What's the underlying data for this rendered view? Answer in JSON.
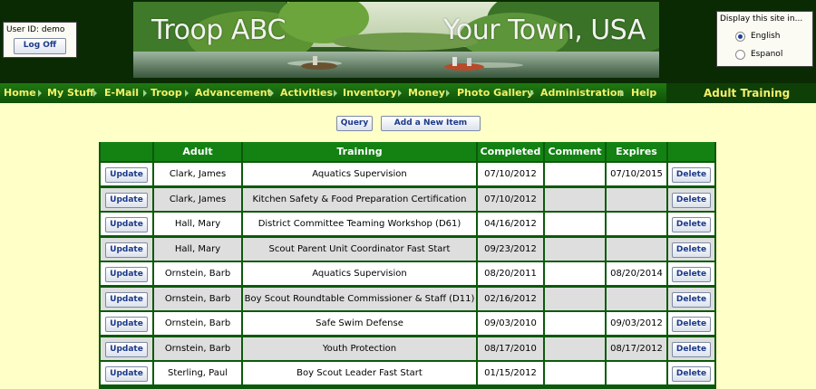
{
  "user": {
    "id_label": "User ID:  demo",
    "logoff_label": "Log Off"
  },
  "banner": {
    "left_text": "Troop ABC",
    "right_text": "Your Town, USA"
  },
  "language": {
    "title": "Display this site in...",
    "options": [
      {
        "label": "English",
        "selected": true
      },
      {
        "label": "Espanol",
        "selected": false
      }
    ]
  },
  "nav": {
    "items": [
      "Home",
      "My Stuff",
      "E-Mail",
      "Troop",
      "Advancement",
      "Activities",
      "Inventory",
      "Money",
      "Photo Gallery",
      "Administration",
      "Help"
    ],
    "page_title": "Adult Training"
  },
  "actions": {
    "query_label": "Query",
    "add_label": "Add a New Item"
  },
  "table": {
    "headers": [
      "",
      "Adult",
      "Training",
      "Completed",
      "Comment",
      "Expires",
      ""
    ],
    "update_label": "Update",
    "delete_label": "Delete",
    "rows": [
      {
        "adult": "Clark, James",
        "training": "Aquatics Supervision",
        "completed": "07/10/2012",
        "comment": "",
        "expires": "07/10/2015"
      },
      {
        "adult": "Clark, James",
        "training": "Kitchen Safety & Food Preparation Certification",
        "completed": "07/10/2012",
        "comment": "",
        "expires": ""
      },
      {
        "adult": "Hall, Mary",
        "training": "District Committee Teaming Workshop (D61)",
        "completed": "04/16/2012",
        "comment": "",
        "expires": ""
      },
      {
        "adult": "Hall, Mary",
        "training": "Scout Parent Unit Coordinator Fast Start",
        "completed": "09/23/2012",
        "comment": "",
        "expires": ""
      },
      {
        "adult": "Ornstein, Barb",
        "training": "Aquatics Supervision",
        "completed": "08/20/2011",
        "comment": "",
        "expires": "08/20/2014"
      },
      {
        "adult": "Ornstein, Barb",
        "training": "Boy Scout Roundtable Commissioner & Staff (D11)",
        "completed": "02/16/2012",
        "comment": "",
        "expires": ""
      },
      {
        "adult": "Ornstein, Barb",
        "training": "Safe Swim Defense",
        "completed": "09/03/2010",
        "comment": "",
        "expires": "09/03/2012"
      },
      {
        "adult": "Ornstein, Barb",
        "training": "Youth Protection",
        "completed": "08/17/2010",
        "comment": "",
        "expires": "08/17/2012"
      },
      {
        "adult": "Sterling, Paul",
        "training": "Boy Scout Leader Fast Start",
        "completed": "01/15/2012",
        "comment": "",
        "expires": ""
      }
    ]
  }
}
